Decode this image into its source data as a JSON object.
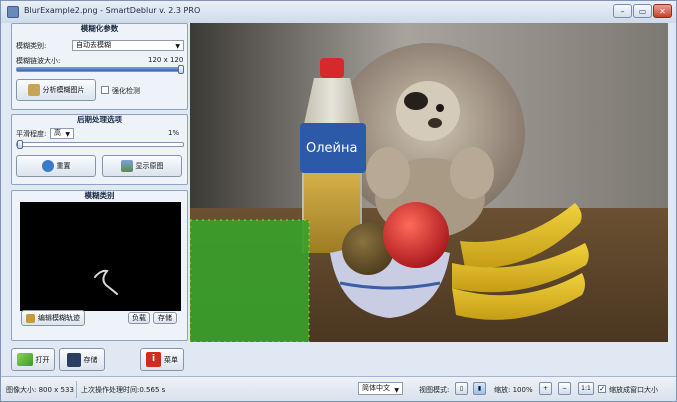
{
  "window": {
    "title": "BlurExample2.png - SmartDeblur v. 2.3 PRO"
  },
  "titlebar_buttons": {
    "minimize": "–",
    "maximize": "▭",
    "close": "✕"
  },
  "blur_params": {
    "title": "模糊化参数",
    "blur_type_label": "模糊类别:",
    "blur_type_value": "自动去模糊",
    "blur_size_label": "模糊链波大小:",
    "blur_size_value": "120 x 120",
    "blur_size_level": 1.0,
    "analyze_button": "分析模糊图片",
    "fine_detect_label": "强化检测"
  },
  "post_processing": {
    "title": "后期处理选项",
    "smooth_label": "平滑程度:",
    "smooth_value": "高",
    "percent_label": "1%",
    "level": 0.01,
    "reset_button": "重置",
    "show_original_button": "显示原图"
  },
  "blur_kernel": {
    "title": "模糊类别",
    "edit_button": "编辑模糊轨迹",
    "load_button": "负载",
    "save_button": "存储"
  },
  "bottom_buttons": {
    "open": "打开",
    "save": "存储",
    "menu": "菜单"
  },
  "status": {
    "image_size": "图像大小: 800 x 533",
    "last_time": "上次操作处理时间:0.565 s",
    "language": "简体中文",
    "view_mode_label": "视图模式:",
    "zoom_label": "缩放: 100%",
    "zoom_in": "+",
    "zoom_out": "−",
    "one_to_one": "1:1",
    "fit_label": "缩放成窗口大小"
  },
  "icons": {
    "open": "folder-check-icon",
    "save": "floppy-icon",
    "menu": "info-icon"
  }
}
